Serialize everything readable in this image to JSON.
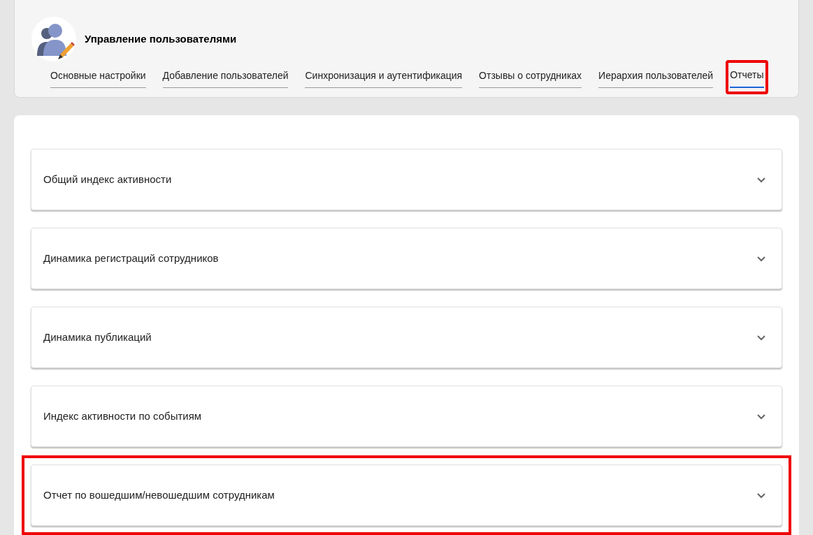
{
  "header": {
    "title": "Управление пользователями"
  },
  "tabs": [
    {
      "label": "Основные настройки",
      "selected": false,
      "highlighted": false
    },
    {
      "label": "Добавление пользователей",
      "selected": false,
      "highlighted": false
    },
    {
      "label": "Синхронизация и аутентификация",
      "selected": false,
      "highlighted": false
    },
    {
      "label": "Отзывы о сотрудниках",
      "selected": false,
      "highlighted": false
    },
    {
      "label": "Иерархия пользователей",
      "selected": false,
      "highlighted": false
    },
    {
      "label": "Отчеты",
      "selected": true,
      "highlighted": true
    }
  ],
  "reports": [
    {
      "title": "Общий индекс активности",
      "expanded": false,
      "highlighted": false
    },
    {
      "title": "Динамика регистраций сотрудников",
      "expanded": false,
      "highlighted": false
    },
    {
      "title": "Динамика публикаций",
      "expanded": false,
      "highlighted": false
    },
    {
      "title": "Индекс активности по событиям",
      "expanded": false,
      "highlighted": false
    },
    {
      "title": "Отчет по вошедшим/невошедшим сотрудникам",
      "expanded": false,
      "highlighted": true
    }
  ]
}
